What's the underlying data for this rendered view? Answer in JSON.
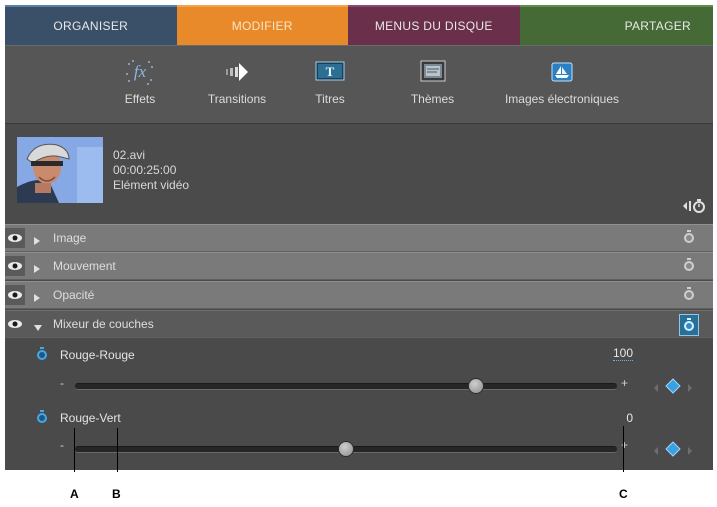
{
  "tabs": [
    {
      "label": "ORGANISER"
    },
    {
      "label": "MODIFIER"
    },
    {
      "label": "MENUS DU DISQUE"
    },
    {
      "label": "PARTAGER"
    }
  ],
  "toolbar": {
    "items": [
      {
        "label": "Effets",
        "icon": "fx-icon"
      },
      {
        "label": "Transitions",
        "icon": "transitions-icon"
      },
      {
        "label": "Titres",
        "icon": "titles-icon"
      },
      {
        "label": "Thèmes",
        "icon": "themes-icon"
      },
      {
        "label": "Images électroniques",
        "icon": "clipart-icon"
      }
    ]
  },
  "clip": {
    "name": "02.avi",
    "duration": "00:00:25:00",
    "type": "Elément vidéo"
  },
  "properties": [
    {
      "label": "Image",
      "expanded": false
    },
    {
      "label": "Mouvement",
      "expanded": false
    },
    {
      "label": "Opacité",
      "expanded": false
    },
    {
      "label": "Mixeur de couches",
      "expanded": true
    }
  ],
  "parameters": [
    {
      "label": "Rouge-Rouge",
      "value": "100",
      "minus": "-",
      "plus": "+",
      "level": 0.74
    },
    {
      "label": "Rouge-Vert",
      "value": "0",
      "minus": "-",
      "plus": "+",
      "level": 0.5
    }
  ],
  "callouts": {
    "a": "A",
    "b": "B",
    "c": "C"
  },
  "colors": {
    "organiser": "#3a5068",
    "modifier": "#e8892a",
    "menus": "#6a2f4a",
    "partager": "#466a36",
    "keyframe_blue": "#2a8fd0"
  }
}
